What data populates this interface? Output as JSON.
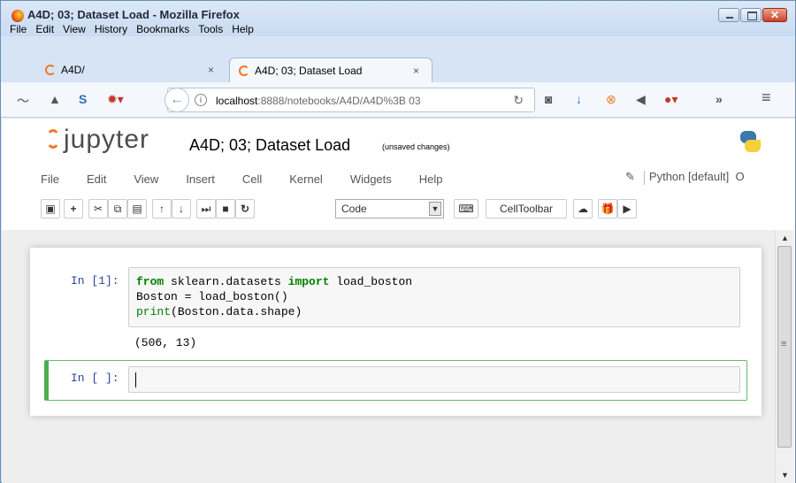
{
  "window": {
    "title": "A4D; 03; Dataset Load - Mozilla Firefox",
    "menu": [
      "File",
      "Edit",
      "View",
      "History",
      "Bookmarks",
      "Tools",
      "Help"
    ]
  },
  "tabs": [
    {
      "label": "A4D/",
      "active": false
    },
    {
      "label": "A4D; 03; Dataset Load",
      "active": true
    }
  ],
  "tab_close_glyph": "×",
  "navbar": {
    "url_host": "localhost",
    "url_path": ":8888/notebooks/A4D/A4D%3B 03",
    "overflow_glyph": "»",
    "menu_glyph": "≡"
  },
  "jupyter": {
    "logo_text": "jupyter",
    "notebook_name": "A4D; 03; Dataset Load",
    "save_status": "(unsaved changes)",
    "menu": [
      "File",
      "Edit",
      "View",
      "Insert",
      "Cell",
      "Kernel",
      "Widgets",
      "Help"
    ],
    "kernel_name": "Python [default]",
    "kernel_indicator": "O",
    "cell_type": "Code",
    "celltoolbar_label": "CellToolbar"
  },
  "cells": [
    {
      "prompt": "In [1]:",
      "code_lines": [
        {
          "parts": [
            {
              "t": "from",
              "c": "kw"
            },
            {
              "t": " sklearn.datasets ",
              "c": ""
            },
            {
              "t": "import",
              "c": "kw"
            },
            {
              "t": " load_boston",
              "c": ""
            }
          ]
        },
        {
          "parts": [
            {
              "t": "Boston = load_boston()",
              "c": ""
            }
          ]
        },
        {
          "parts": [
            {
              "t": "print",
              "c": "fn"
            },
            {
              "t": "(Boston.data.shape)",
              "c": ""
            }
          ]
        }
      ],
      "output": "(506, 13)"
    },
    {
      "prompt": "In [ ]:",
      "code_lines": [],
      "output": ""
    }
  ],
  "colors": {
    "jupyter_orange": "#f37626",
    "prompt_blue": "#303f9f",
    "keyword_green": "#008000",
    "selected_cell_border": "#66bb6a"
  }
}
